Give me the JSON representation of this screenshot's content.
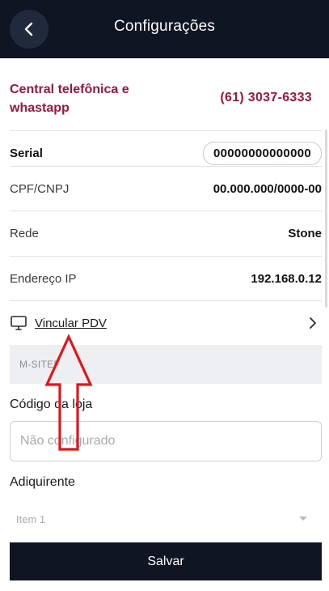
{
  "header": {
    "title": "Configurações",
    "back_icon": "chevron-left-icon"
  },
  "support": {
    "label": "Central telefônica e whastapp",
    "phone": "(61) 3037-6333"
  },
  "rows": [
    {
      "label": "Serial",
      "value": "00000000000000"
    },
    {
      "label": "CPF/CNPJ",
      "value": "00.000.000/0000-00"
    },
    {
      "label": "Rede",
      "value": "Stone"
    },
    {
      "label": "Endereço IP",
      "value": "192.168.0.12"
    }
  ],
  "vincular": {
    "label": "Vincular PDV",
    "icon": "monitor-icon",
    "chevron": "chevron-right-icon"
  },
  "section": {
    "title": "M-SITEF"
  },
  "store_code": {
    "label": "Código da loja",
    "placeholder": "Não configurado",
    "value": ""
  },
  "acquirer": {
    "label": "Adiquirente",
    "selected": "Item 1"
  },
  "actions": {
    "save_label": "Salvar"
  },
  "colors": {
    "header_bg": "#0f1522",
    "accent": "#a3143c",
    "annotation_arrow": "#e3141b"
  }
}
